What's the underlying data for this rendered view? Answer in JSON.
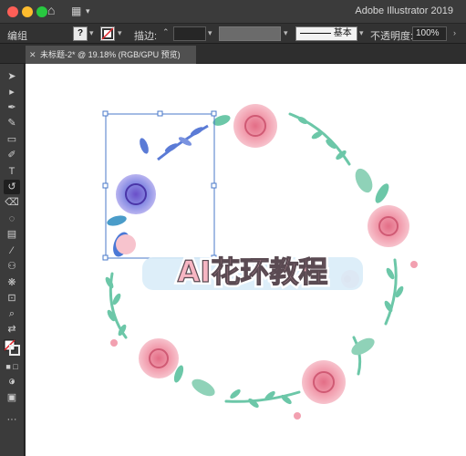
{
  "window": {
    "app_title": "Adobe Illustrator 2019"
  },
  "control_bar": {
    "group_label": "编组",
    "stroke_label": "描边:",
    "stroke_style": "基本",
    "opacity_label": "不透明度:",
    "opacity_value": "100%"
  },
  "document_tab": {
    "title": "未标题-2* @ 19.18% (RGB/GPU 预览)"
  },
  "artwork": {
    "title_text": "AI花环教程"
  },
  "colors": {
    "rose": "#f2a0b0",
    "leaf": "#6cc7a8",
    "blue": "#5b7bd6",
    "selection": "#4a78c8"
  }
}
